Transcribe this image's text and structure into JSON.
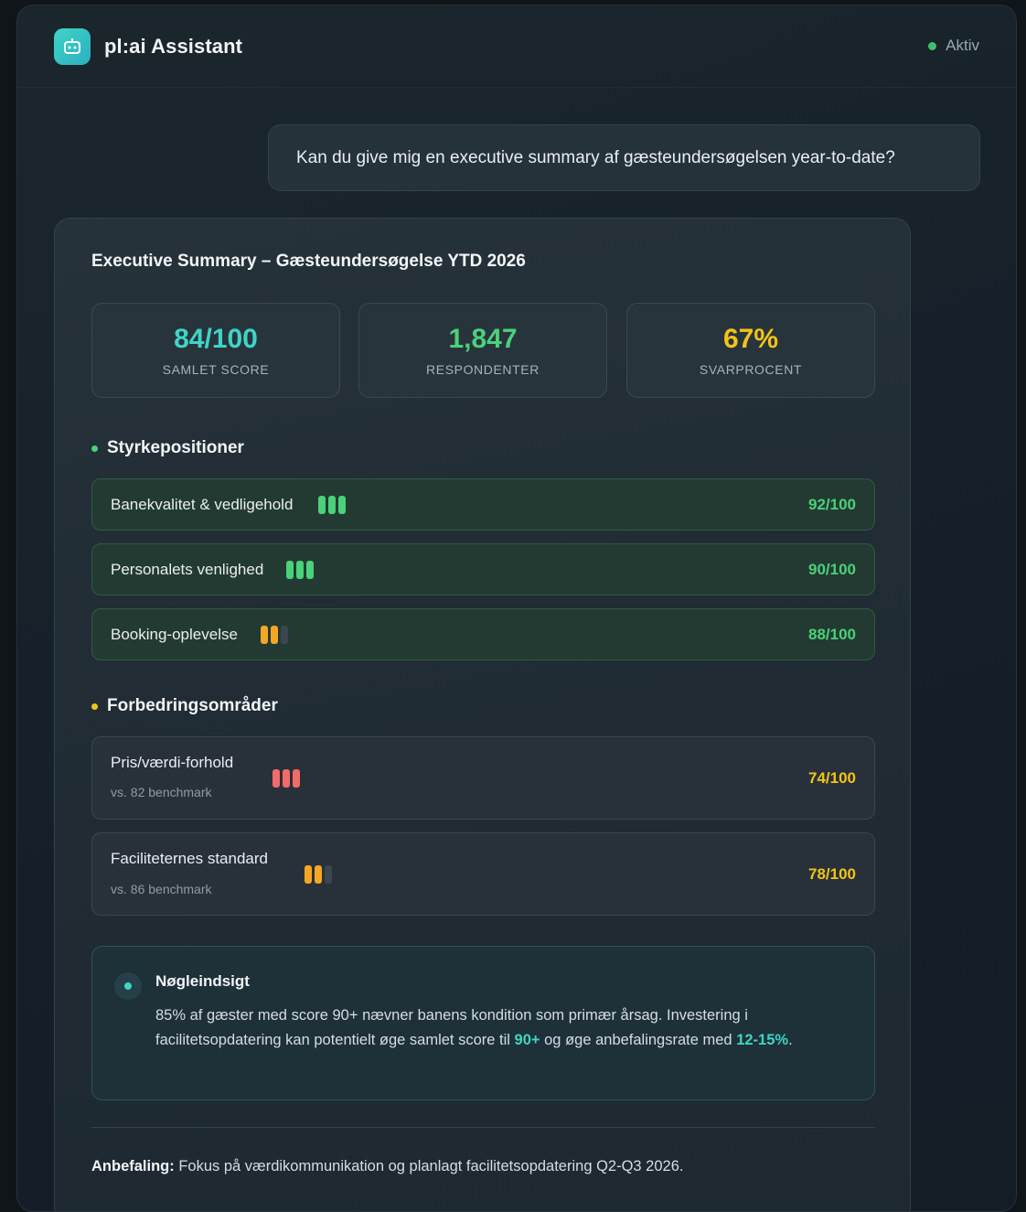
{
  "header": {
    "app_icon": "robot-icon",
    "title": "pl:ai Assistant",
    "status": "Aktiv",
    "status_color": "#3fbf6a"
  },
  "chat": {
    "user_message": "Kan du give mig en executive summary af gæsteundersøgelsen year-to-date?"
  },
  "summary": {
    "title": "Executive Summary – Gæsteundersøgelse YTD 2026",
    "stats": [
      {
        "value": "84/100",
        "label": "SAMLET SCORE",
        "color": "#3fd4c6"
      },
      {
        "value": "1,847",
        "label": "RESPONDENTER",
        "color": "#4ad17a"
      },
      {
        "value": "67%",
        "label": "SVARPROCENT",
        "color": "#f2c417"
      }
    ],
    "strengths_title": "Styrkepositioner",
    "strengths_dot_color": "#4ad17a",
    "strengths": [
      {
        "label": "Banekvalitet & vedligehold",
        "value": "92/100",
        "bars_filled": 3,
        "bar_color": "#4ad17a",
        "value_color": "#4ad17a"
      },
      {
        "label": "Personalets venlighed",
        "value": "90/100",
        "bars_filled": 3,
        "bar_color": "#4ad17a",
        "value_color": "#4ad17a"
      },
      {
        "label": "Booking-oplevelse",
        "value": "88/100",
        "bars_filled": 2,
        "bar_color": "#f5a623",
        "value_color": "#4ad17a"
      }
    ],
    "improvements_title": "Forbedringsområder",
    "improvements_dot_color": "#f2c417",
    "improvements": [
      {
        "label": "Pris/værdi-forhold",
        "sub": "vs. 82 benchmark",
        "value": "74/100",
        "bars_filled": 3,
        "bar_color": "#f26b6b",
        "value_color": "#f2c417"
      },
      {
        "label": "Faciliteternes standard",
        "sub": "vs. 86 benchmark",
        "value": "78/100",
        "bars_filled": 2,
        "bar_color": "#f5a623",
        "value_color": "#f2c417"
      }
    ],
    "insight": {
      "icon": "dot-icon",
      "title": "Nøgleindsigt",
      "text_1": "85% af gæster med score 90+ nævner banens kondition som primær årsag. Investering i facilitetsopdatering kan potentielt øge samlet score til ",
      "hl_1": "90+",
      "text_2": " og øge anbefalingsrate med ",
      "hl_2": "12-15%",
      "text_3": "."
    },
    "recommendation_label": "Anbefaling:",
    "recommendation_text": " Fokus på værdikommunikation og planlagt facilitetsopdatering Q2-Q3 2026."
  }
}
